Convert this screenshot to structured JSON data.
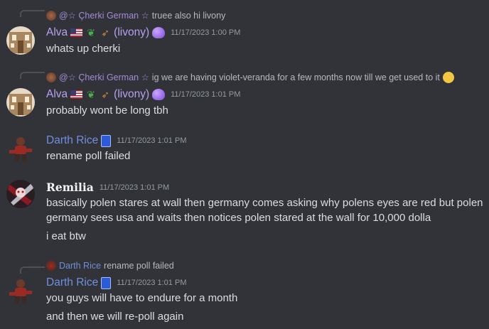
{
  "messages": [
    {
      "reply": {
        "name": "@☆ Çherki German ☆",
        "text": "truee also hi livony"
      },
      "author": "Alva",
      "author_suffix": "(livony)",
      "timestamp": "11/17/2023 1:00 PM",
      "lines": [
        "whats up cherki"
      ]
    },
    {
      "reply": {
        "name": "@☆ Çherki German ☆",
        "text": "ig we are having violet-veranda for a few months now till we get used to it"
      },
      "author": "Alva",
      "author_suffix": "(livony)",
      "timestamp": "11/17/2023 1:01 PM",
      "lines": [
        "probably wont be long tbh"
      ]
    },
    {
      "author": "Darth Rice",
      "timestamp": "11/17/2023 1:01 PM",
      "lines": [
        "rename poll failed"
      ]
    },
    {
      "author": "Remilia",
      "timestamp": "11/17/2023 1:01 PM",
      "lines": [
        "basically polen stares at wall then germany comes asking why polens eyes are red but polen",
        "germany sees usa and waits then notices polen stared at the wall for 10,000 dolla",
        "i eat btw"
      ]
    },
    {
      "reply": {
        "name": "Darth Rice",
        "text": "rename poll failed"
      },
      "author": "Darth Rice",
      "timestamp": "11/17/2023 1:01 PM",
      "lines": [
        "you guys will have to endure for a month",
        "and then we will re-poll again"
      ]
    }
  ],
  "icons": {
    "flag": "us-flag-icon",
    "frog": "frog-icon",
    "bird": "bird-icon",
    "blob": "purple-blob-icon",
    "book": "blue-book-icon",
    "pensive": "pensive-emoji"
  },
  "colors": {
    "background": "#313338",
    "text": "#dbdee1",
    "timestamp": "#949ba4",
    "alva": "#b8a1ef",
    "darth_rice": "#6f90e0",
    "reply_name": "#a58bd8"
  }
}
